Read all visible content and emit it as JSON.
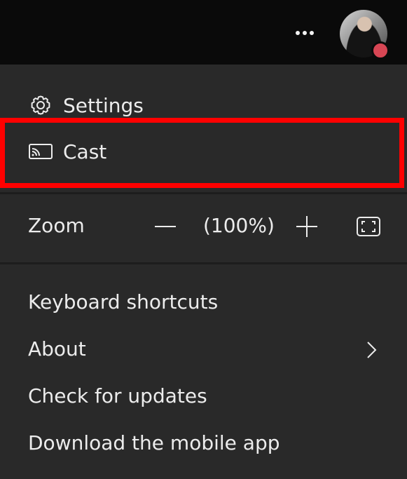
{
  "topbar": {
    "more_icon": "more-horizontal-icon",
    "presence_color": "#d74654"
  },
  "menu": {
    "settings_label": "Settings",
    "cast_label": "Cast",
    "zoom": {
      "label": "Zoom",
      "value": "(100%)"
    },
    "keyboard_shortcuts_label": "Keyboard shortcuts",
    "about_label": "About",
    "check_updates_label": "Check for updates",
    "download_mobile_label": "Download the mobile app"
  },
  "colors": {
    "highlight": "#ff0000",
    "menu_bg": "#292929",
    "topbar_bg": "#0a0a0a",
    "text": "#ececec"
  }
}
